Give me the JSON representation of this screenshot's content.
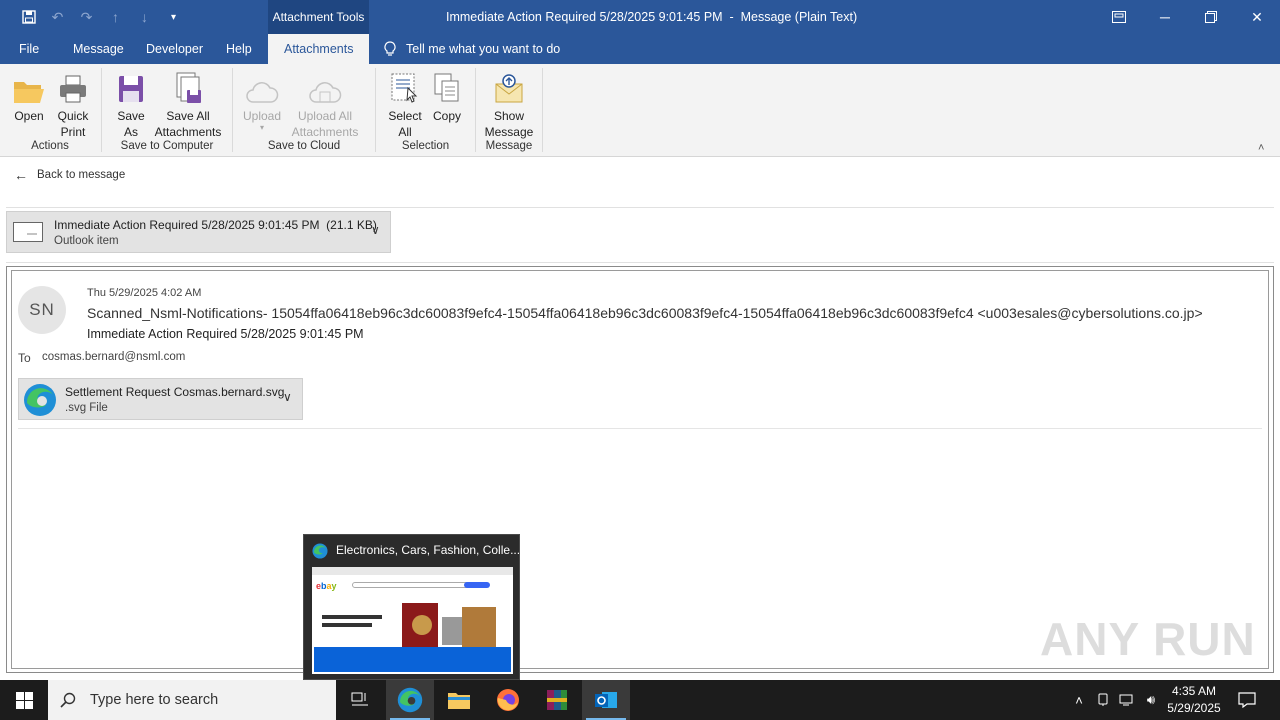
{
  "window": {
    "title": "Immediate Action Required 5/28/2025 9:01:45 PM  -  Message (Plain Text)",
    "contextual_tab_group": "Attachment Tools"
  },
  "menu": {
    "file": "File",
    "message": "Message",
    "developer": "Developer",
    "help": "Help",
    "attachments": "Attachments",
    "tell_me": "Tell me what you want to do"
  },
  "ribbon": {
    "open": "Open",
    "quick_print_1": "Quick",
    "quick_print_2": "Print",
    "actions_label": "Actions",
    "save_as_1": "Save",
    "save_as_2": "As",
    "save_all_1": "Save All",
    "save_all_2": "Attachments",
    "save_to_computer_label": "Save to Computer",
    "upload": "Upload",
    "upload_all_1": "Upload All",
    "upload_all_2": "Attachments",
    "save_to_cloud_label": "Save to Cloud",
    "select_all_1": "Select",
    "select_all_2": "All",
    "copy": "Copy",
    "selection_label": "Selection",
    "show_message_1": "Show",
    "show_message_2": "Message",
    "message_label": "Message"
  },
  "back_link": "Back to message",
  "outlook_item": {
    "name": "Immediate Action Required 5/28/2025 9:01:45 PM  (21.1 KB)",
    "type": "Outlook item"
  },
  "email": {
    "avatar_initials": "SN",
    "date": "Thu 5/29/2025 4:02 AM",
    "from": "Scanned_Nsml-Notifications- 15054ffa06418eb96c3dc60083f9efc4-15054ffa06418eb96c3dc60083f9efc4-15054ffa06418eb96c3dc60083f9efc4 <u003esales@cybersolutions.co.jp>",
    "subject": "Immediate Action Required 5/28/2025 9:01:45 PM",
    "to_label": "To",
    "to": "cosmas.bernard@nsml.com",
    "attachment_name": "Settlement Request Cosmas.bernard.svg",
    "attachment_type": ".svg File"
  },
  "taskbar_preview": {
    "title": "Electronics, Cars, Fashion, Colle..."
  },
  "watermark": "ANY RUN",
  "taskbar": {
    "search_placeholder": "Type here to search",
    "time": "4:35 AM",
    "date": "5/29/2025"
  },
  "colors": {
    "title_bar": "#2b579a",
    "ribbon_bg": "#f3f3f3",
    "taskbar_bg": "#1c1c1c"
  }
}
